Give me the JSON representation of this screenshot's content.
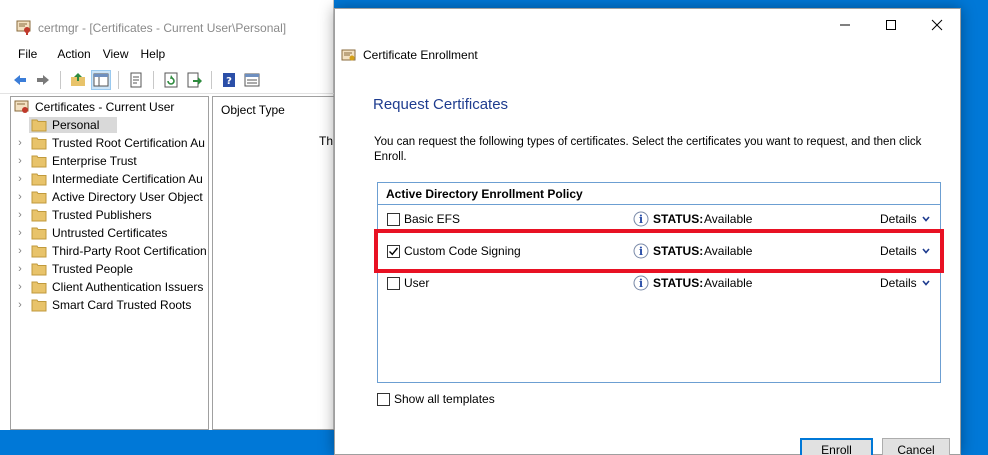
{
  "certmgr": {
    "title": "certmgr - [Certificates - Current User\\Personal]",
    "menu": [
      "File",
      "Action",
      "View",
      "Help"
    ],
    "toolbar_icons": [
      "back-icon",
      "forward-icon",
      "up-folder-icon",
      "show-hide-tree-icon",
      "properties-icon",
      "refresh-icon",
      "export-icon",
      "help-icon",
      "details-view-icon"
    ],
    "tree": {
      "root": "Certificates - Current User",
      "items": [
        {
          "label": "Personal",
          "selected": true,
          "expandable": false
        },
        {
          "label": "Trusted Root Certification Au",
          "expandable": true
        },
        {
          "label": "Enterprise Trust",
          "expandable": true
        },
        {
          "label": "Intermediate Certification Au",
          "expandable": true
        },
        {
          "label": "Active Directory User Object",
          "expandable": true
        },
        {
          "label": "Trusted Publishers",
          "expandable": true
        },
        {
          "label": "Untrusted Certificates",
          "expandable": true
        },
        {
          "label": "Third-Party Root Certification",
          "expandable": true
        },
        {
          "label": "Trusted People",
          "expandable": true
        },
        {
          "label": "Client Authentication Issuers",
          "expandable": true
        },
        {
          "label": "Smart Card Trusted Roots",
          "expandable": true
        }
      ]
    },
    "list": {
      "column_header": "Object Type",
      "clipped_text": "Th"
    }
  },
  "dialog": {
    "header_title": "Certificate Enrollment",
    "heading": "Request Certificates",
    "description": "You can request the following types of certificates. Select the certificates you want to request, and then click Enroll.",
    "policy_title": "Active Directory Enrollment Policy",
    "certificates": [
      {
        "name": "Basic EFS",
        "checked": false,
        "status_label": "STATUS:",
        "status": "Available",
        "details": "Details"
      },
      {
        "name": "Custom Code Signing",
        "checked": true,
        "status_label": "STATUS:",
        "status": "Available",
        "details": "Details"
      },
      {
        "name": "User",
        "checked": false,
        "status_label": "STATUS:",
        "status": "Available",
        "details": "Details"
      }
    ],
    "show_all_templates": {
      "label": "Show all templates",
      "checked": false
    },
    "buttons": {
      "enroll": "Enroll",
      "cancel": "Cancel"
    }
  },
  "colors": {
    "desktop": "#0078d7",
    "heading": "#1e3c8f",
    "highlight": "#e81123",
    "policy_border": "#6c9fd2",
    "selected_tree": "#d9d9d9"
  }
}
